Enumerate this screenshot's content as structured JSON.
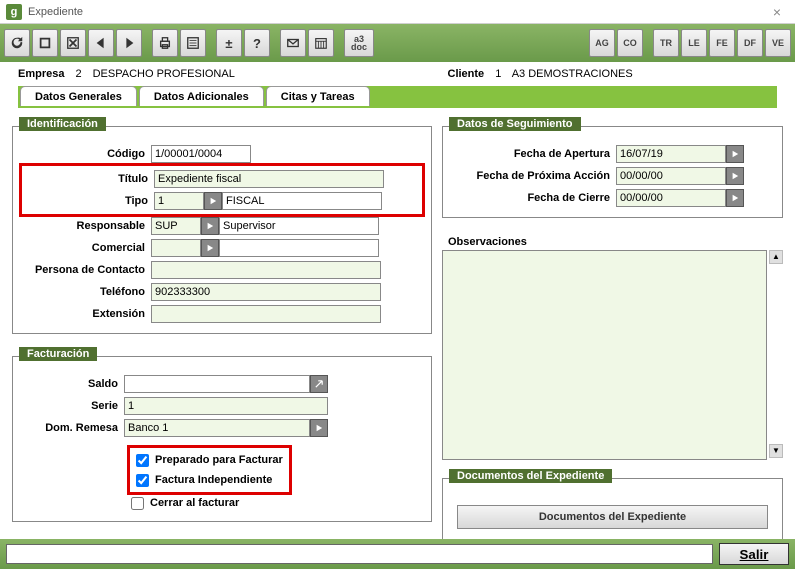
{
  "window": {
    "title": "Expediente"
  },
  "header": {
    "empresa_label": "Empresa",
    "empresa_num": "2",
    "empresa_name": "DESPACHO PROFESIONAL",
    "cliente_label": "Cliente",
    "cliente_num": "1",
    "cliente_name": "A3 DEMOSTRACIONES"
  },
  "tabs": {
    "t1": "Datos Generales",
    "t2": "Datos Adicionales",
    "t3": "Citas y Tareas"
  },
  "ident": {
    "legend": "Identificación",
    "codigo_label": "Código",
    "codigo_val": "1/00001/0004",
    "titulo_label": "Título",
    "titulo_val": "Expediente fiscal",
    "tipo_label": "Tipo",
    "tipo_code": "1",
    "tipo_desc": "FISCAL",
    "resp_label": "Responsable",
    "resp_code": "SUP",
    "resp_desc": "Supervisor",
    "comercial_label": "Comercial",
    "comercial_code": "",
    "comercial_desc": "",
    "contacto_label": "Persona de  Contacto",
    "contacto_val": "",
    "telefono_label": "Teléfono",
    "telefono_val": "902333300",
    "extension_label": "Extensión",
    "extension_val": ""
  },
  "fact": {
    "legend": "Facturación",
    "saldo_label": "Saldo",
    "saldo_val": "",
    "serie_label": "Serie",
    "serie_val": "1",
    "domremesa_label": "Dom. Remesa",
    "domremesa_val": "Banco 1",
    "chk1": "Preparado para Facturar",
    "chk2": "Factura Independiente",
    "chk3": "Cerrar al facturar"
  },
  "seg": {
    "legend": "Datos de Seguimiento",
    "apertura_label": "Fecha de Apertura",
    "apertura_val": "16/07/19",
    "proxima_label": "Fecha de Próxima Acción",
    "proxima_val": "00/00/00",
    "cierre_label": "Fecha de Cierre",
    "cierre_val": "00/00/00"
  },
  "obs_label": "Observaciones",
  "docexp": {
    "legend": "Documentos del Expediente",
    "button": "Documentos del Expediente"
  },
  "footer": {
    "exit": "Salir"
  },
  "toolbar": {
    "a3_top": "a3",
    "a3_bot": "doc"
  }
}
